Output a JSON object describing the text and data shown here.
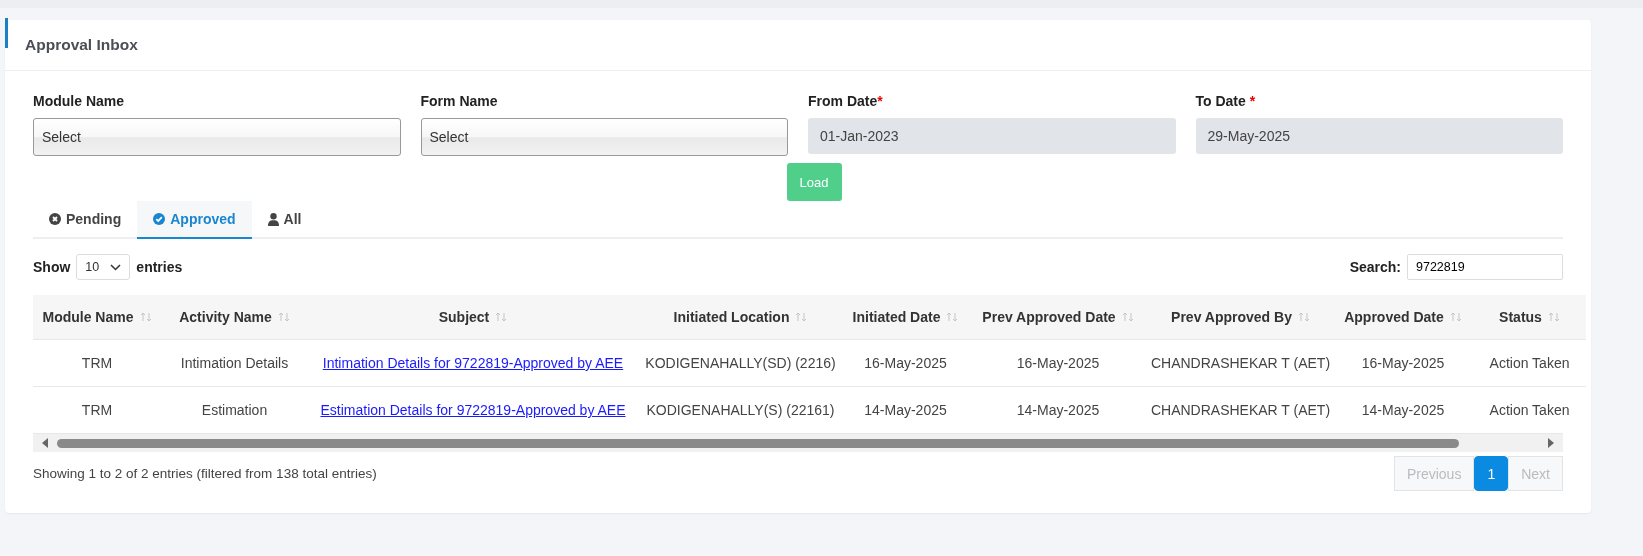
{
  "panel": {
    "title": "Approval Inbox"
  },
  "filters": [
    {
      "kind": "select",
      "label": "Module Name",
      "value": "Select"
    },
    {
      "kind": "select",
      "label": "Form Name",
      "value": "Select"
    },
    {
      "kind": "date",
      "label": "From Date",
      "required_mark": "*",
      "value": "01-Jan-2023"
    },
    {
      "kind": "date",
      "label": "To Date ",
      "required_mark": "*",
      "value": "29-May-2025"
    }
  ],
  "load_button": "Load",
  "tabs": [
    {
      "kind": "pending",
      "label": "Pending",
      "selected": false
    },
    {
      "kind": "approved",
      "label": "Approved",
      "selected": true
    },
    {
      "kind": "all",
      "label": "All",
      "selected": false
    }
  ],
  "length": {
    "before": "Show",
    "value": "10",
    "after": "entries"
  },
  "search": {
    "label": "Search:",
    "value": "9722819"
  },
  "table": {
    "columns": [
      "Module Name",
      "Activity Name",
      "Subject",
      "Initiated Location",
      "Initiated Date",
      "Prev Approved Date",
      "Prev Approved By",
      "Approved Date",
      "Status"
    ],
    "rows": [
      [
        "TRM",
        "Intimation Details",
        "Intimation Details for 9722819-Approved by AEE",
        "KODIGENAHALLY(SD) (2216)",
        "16-May-2025",
        "16-May-2025",
        "CHANDRASHEKAR T (AET)",
        "16-May-2025",
        "Action Taken"
      ],
      [
        "TRM",
        "Estimation",
        "Estimation Details for 9722819-Approved by AEE",
        "KODIGENAHALLY(S) (22161)",
        "14-May-2025",
        "14-May-2025",
        "CHANDRASHEKAR T (AET)",
        "14-May-2025",
        "Action Taken"
      ]
    ]
  },
  "info": "Showing 1 to 2 of 2 entries (filtered from 138 total entries)",
  "pagination": [
    {
      "label": "Previous",
      "selected": false,
      "disabled": true
    },
    {
      "label": "1",
      "selected": true,
      "disabled": false
    },
    {
      "label": "Next",
      "selected": false,
      "disabled": true
    }
  ]
}
